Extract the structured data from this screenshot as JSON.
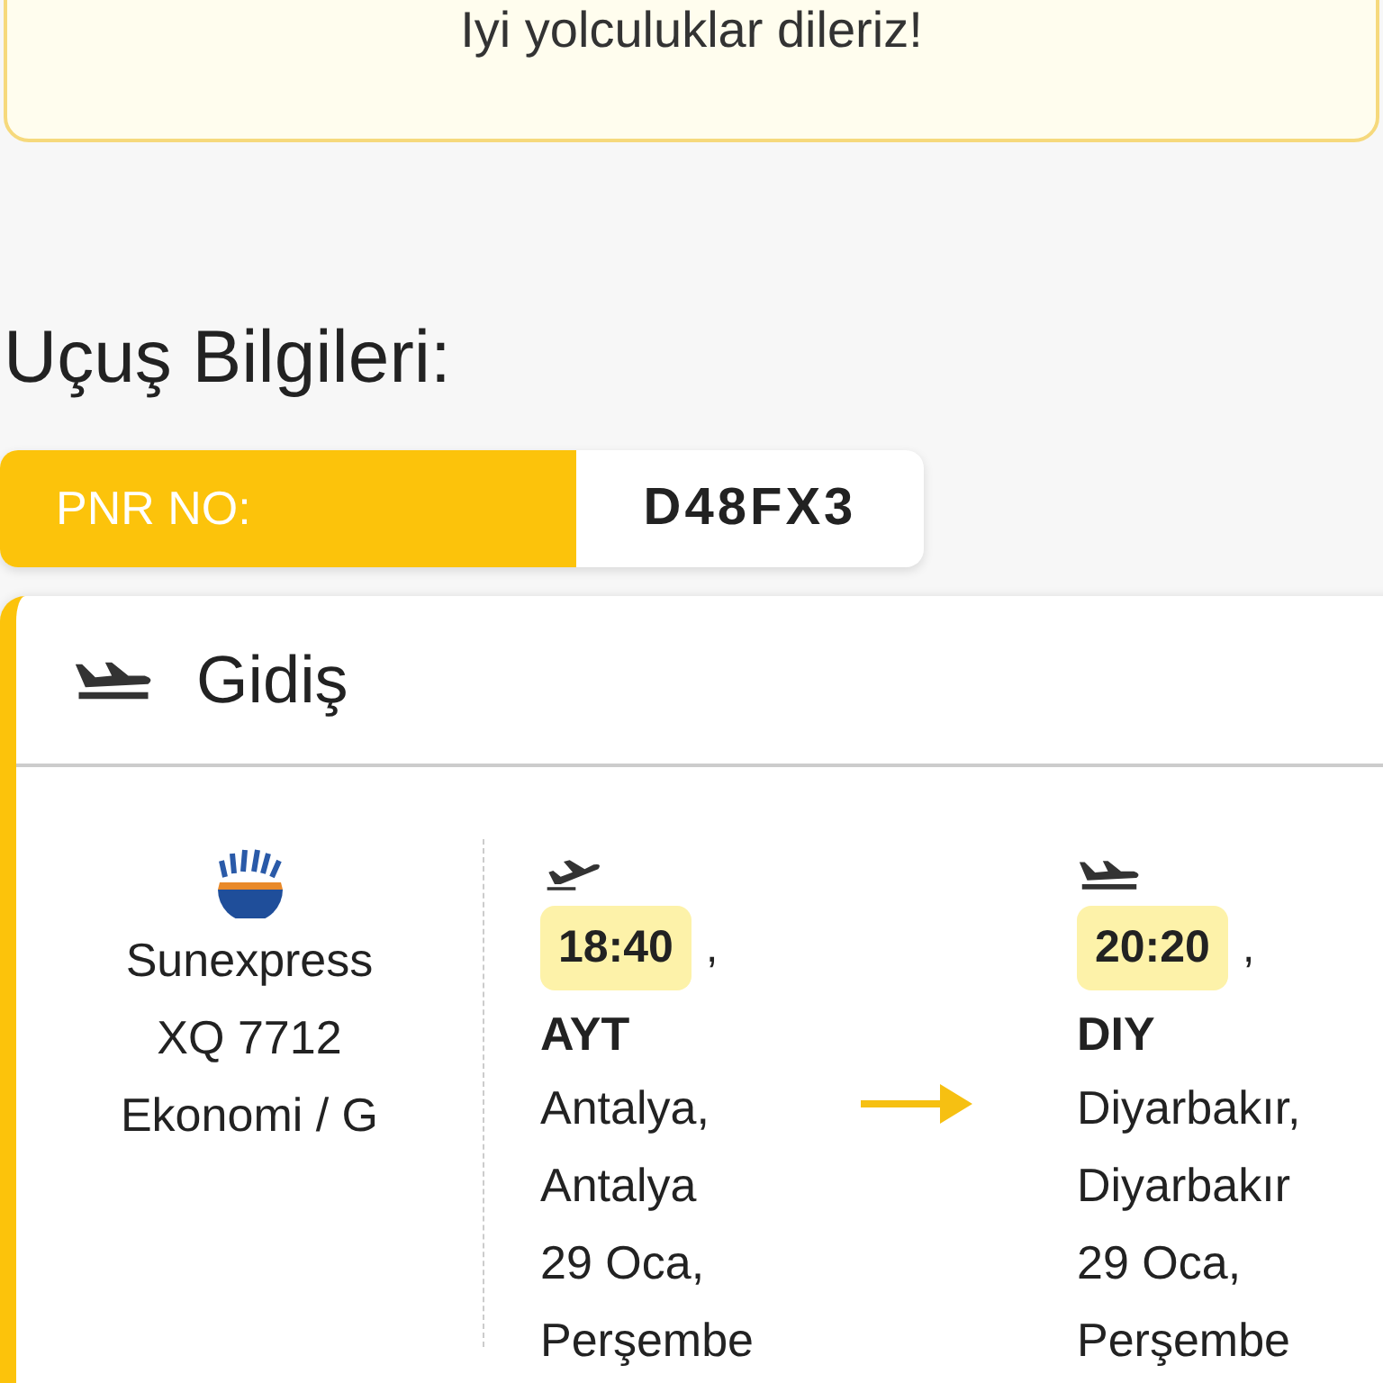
{
  "banner": {
    "text": "Iyi yolculuklar dileriz!"
  },
  "section_title": "Uçuş Bilgileri:",
  "pnr": {
    "label": "PNR NO:",
    "value": "D48FX3"
  },
  "flight": {
    "title": "Gidiş",
    "airline": {
      "name": "Sunexpress",
      "number": "XQ 7712",
      "cabin": "Ekonomi / G"
    },
    "legs": [
      {
        "kind": "departure",
        "time": "18:40",
        "separator": ",",
        "code": "AYT",
        "lines": [
          "Antalya,",
          "Antalya",
          "29 Oca,",
          "Perşembe"
        ]
      },
      {
        "kind": "arrival",
        "time": "20:20",
        "separator": ",",
        "code": "DIY",
        "lines": [
          "Diyarbakır,",
          "Diyarbakır",
          "29 Oca,",
          "Perşembe"
        ]
      }
    ]
  }
}
